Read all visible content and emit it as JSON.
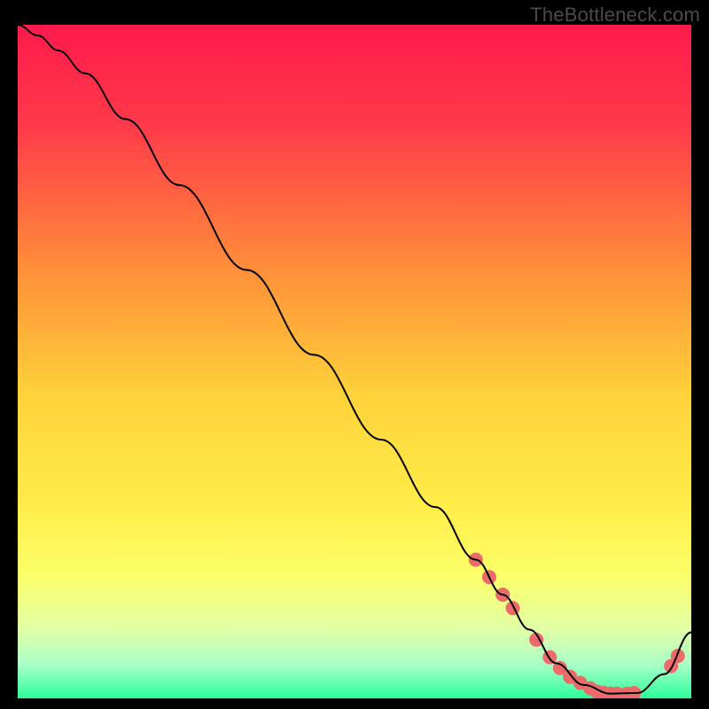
{
  "watermark": "TheBottleneck.com",
  "chart_data": {
    "type": "line",
    "title": "",
    "xlabel": "",
    "ylabel": "",
    "xlim": [
      0,
      100
    ],
    "ylim": [
      0,
      100
    ],
    "grid": false,
    "legend": false,
    "gradient_stops": [
      {
        "offset": 0.0,
        "color": "#ff1a4b"
      },
      {
        "offset": 0.15,
        "color": "#ff3a4a"
      },
      {
        "offset": 0.35,
        "color": "#ff8a3a"
      },
      {
        "offset": 0.55,
        "color": "#ffd23a"
      },
      {
        "offset": 0.72,
        "color": "#ffee4a"
      },
      {
        "offset": 0.82,
        "color": "#fbff6a"
      },
      {
        "offset": 0.9,
        "color": "#dfffa8"
      },
      {
        "offset": 0.95,
        "color": "#a8ffc8"
      },
      {
        "offset": 1.0,
        "color": "#2bff9a"
      }
    ],
    "series": [
      {
        "name": "curve",
        "color": "#000000",
        "x": [
          0,
          3,
          6,
          10,
          16,
          24,
          34,
          44,
          54,
          62,
          68,
          72,
          76,
          80,
          84,
          88,
          92,
          96,
          100
        ],
        "y": [
          100,
          98.4,
          96.2,
          92.8,
          86,
          76.2,
          63.6,
          51,
          38.4,
          28.4,
          20.6,
          15.4,
          10.2,
          5.2,
          2.0,
          0.7,
          0.8,
          3.6,
          9.8
        ]
      }
    ],
    "markers": {
      "name": "highlight-points",
      "color": "#ed6a6a",
      "radius": 8,
      "points": [
        {
          "x": 68,
          "y": 20.6
        },
        {
          "x": 70,
          "y": 18.0
        },
        {
          "x": 72,
          "y": 15.4
        },
        {
          "x": 73.5,
          "y": 13.4
        },
        {
          "x": 77,
          "y": 8.7
        },
        {
          "x": 79,
          "y": 6.1
        },
        {
          "x": 80.5,
          "y": 4.5
        },
        {
          "x": 82,
          "y": 3.2
        },
        {
          "x": 83.5,
          "y": 2.3
        },
        {
          "x": 85,
          "y": 1.5
        },
        {
          "x": 86,
          "y": 1.0
        },
        {
          "x": 87,
          "y": 0.8
        },
        {
          "x": 88,
          "y": 0.7
        },
        {
          "x": 89,
          "y": 0.7
        },
        {
          "x": 90.5,
          "y": 0.7
        },
        {
          "x": 91.5,
          "y": 0.8
        },
        {
          "x": 97,
          "y": 4.8
        },
        {
          "x": 98,
          "y": 6.3
        }
      ]
    }
  }
}
